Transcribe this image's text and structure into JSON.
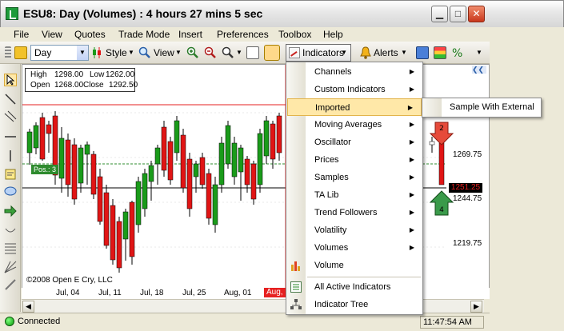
{
  "window": {
    "title": "ESU8: Day (Volumes) : 4 hours 27 mins 5 sec"
  },
  "menu": [
    "File",
    "View",
    "Quotes",
    "Trade Mode",
    "Insert",
    "Preferences",
    "Toolbox",
    "Help"
  ],
  "toolbar": {
    "period": "Day",
    "style_label": "Style",
    "view_label": "View",
    "indicators_label": "Indicators",
    "alerts_label": "Alerts"
  },
  "ohlc": {
    "high_label": "High",
    "high": "1298.00",
    "low_label": "Low",
    "low": "1262.00",
    "open_label": "Open",
    "open": "1268.00",
    "close_label": "Close",
    "close": "1292.50"
  },
  "chart": {
    "copyright": "©2008 Open E Cry, LLC",
    "position_label": "Pos.: 3",
    "price_labels": [
      "1269.75",
      "1244.75",
      "1219.75"
    ],
    "current_price": "1251.25",
    "order_buy": "4",
    "order_sell": "2"
  },
  "date_axis": [
    "Jul, 04",
    "Jul, 11",
    "Jul, 18",
    "Jul, 25",
    "Aug, 01",
    "Aug, 0"
  ],
  "colors": {
    "up": "#1a9b1a",
    "down": "#e01515",
    "crosshair": "#e62020",
    "menu_highlight": "#ffe8a8"
  },
  "indicators_menu": [
    {
      "label": "Channels",
      "submenu": true
    },
    {
      "label": "Custom Indicators",
      "submenu": true
    },
    {
      "label": "Imported",
      "submenu": true
    },
    {
      "label": "Moving Averages",
      "submenu": true
    },
    {
      "label": "Oscillator",
      "submenu": true
    },
    {
      "label": "Prices",
      "submenu": true
    },
    {
      "label": "Samples",
      "submenu": true
    },
    {
      "label": "TA Lib",
      "submenu": true
    },
    {
      "label": "Trend Followers",
      "submenu": true
    },
    {
      "label": "Volatility",
      "submenu": true
    },
    {
      "label": "Volumes",
      "submenu": true
    },
    {
      "label": "Volume",
      "submenu": false
    },
    {
      "label": "All Active Indicators",
      "submenu": false
    },
    {
      "label": "Indicator Tree",
      "submenu": false
    }
  ],
  "submenu_imported": [
    "Sample With External"
  ],
  "status": {
    "connection": "Connected",
    "time": "11:47:54 AM"
  }
}
